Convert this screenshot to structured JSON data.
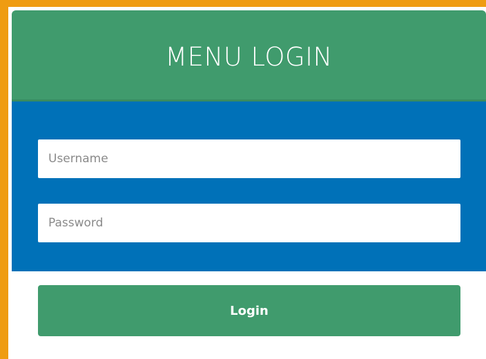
{
  "login": {
    "title": "MENU LOGIN",
    "username": {
      "placeholder": "Username",
      "value": ""
    },
    "password": {
      "placeholder": "Password",
      "value": ""
    },
    "submit_label": "Login"
  },
  "colors": {
    "accent_orange": "#ef9c12",
    "header_green": "#409b6d",
    "body_blue": "#0071b8",
    "button_green": "#409b6d"
  }
}
